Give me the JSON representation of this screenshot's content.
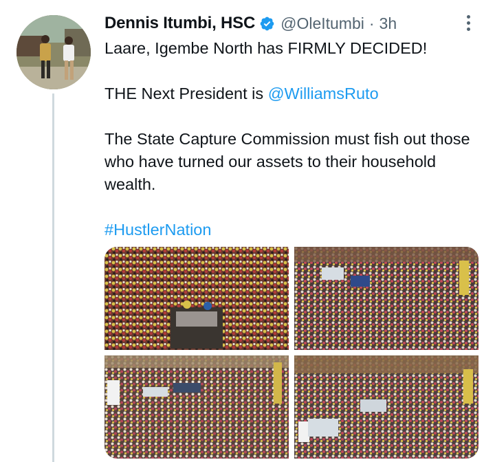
{
  "tweet": {
    "author": {
      "display_name": "Dennis Itumbi, HSC",
      "handle": "@OleItumbi",
      "verified": true
    },
    "separator": "·",
    "time": "3h",
    "lines": {
      "p1": "Laare, Igembe North has FIRMLY DECIDED!",
      "p2_prefix": "THE Next President is ",
      "p2_mention": "@WilliamsRuto",
      "p3": "The State Capture Commission must fish out those who have turned our assets to their household wealth.",
      "hashtag": "#HustlerNation"
    },
    "media_count": 4
  },
  "colors": {
    "link": "#1d9bf0",
    "verified_badge": "#1d9bf0",
    "secondary_text": "#536471",
    "thread_line": "#cfd9de"
  },
  "icons": {
    "verified": "verified-badge-icon",
    "more": "more-options-icon"
  }
}
